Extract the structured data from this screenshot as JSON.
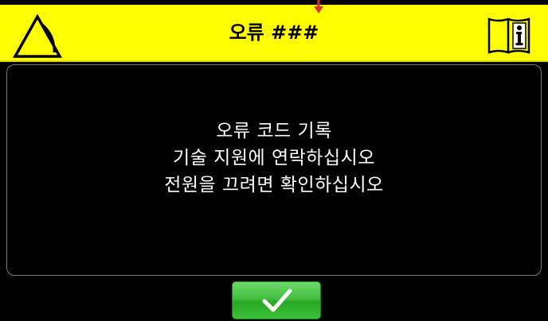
{
  "header": {
    "title": "오류 ###",
    "left_icon": "warning-icon",
    "right_icon": "manual-info-icon"
  },
  "message": {
    "line1": "오류 코드 기록",
    "line2": "기술 지원에 연락하십시오",
    "line3": "전원을 끄려면 확인하십시오"
  },
  "confirm_button": {
    "icon": "checkmark-icon"
  },
  "colors": {
    "header_bg": "#fffd00",
    "screen_bg": "#000000",
    "button_green": "#3ec13a",
    "marker_red": "#d9342b"
  }
}
